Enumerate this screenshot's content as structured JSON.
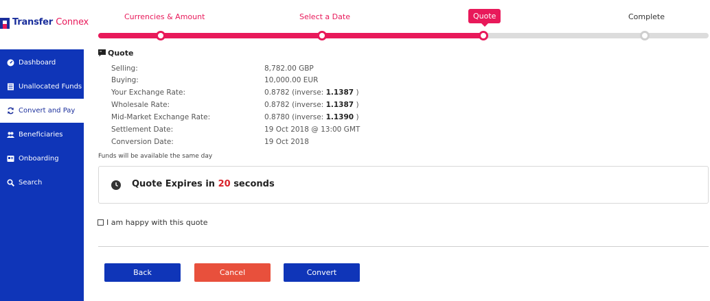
{
  "brand": {
    "name_part1": "Transfer",
    "name_part2": "Connex",
    "color_primary": "#0f35b8",
    "color_accent": "#e8195a"
  },
  "sidebar": {
    "items": [
      {
        "label": "Dashboard",
        "icon": "dashboard-icon",
        "active": false
      },
      {
        "label": "Unallocated Funds",
        "icon": "ledger-icon",
        "active": false
      },
      {
        "label": "Convert and Pay",
        "icon": "refresh-icon",
        "active": true
      },
      {
        "label": "Beneficiaries",
        "icon": "users-icon",
        "active": false
      },
      {
        "label": "Onboarding",
        "icon": "onboarding-icon",
        "active": false
      },
      {
        "label": "Search",
        "icon": "search-icon",
        "active": false
      }
    ]
  },
  "steps": [
    {
      "label": "Currencies & Amount",
      "state": "done"
    },
    {
      "label": "Select a Date",
      "state": "done"
    },
    {
      "label": "Quote",
      "state": "active"
    },
    {
      "label": "Complete",
      "state": "pending"
    }
  ],
  "quote": {
    "title": "Quote",
    "selling_label": "Selling:",
    "selling_value": "8,782.00 GBP",
    "buying_label": "Buying:",
    "buying_value": "10,000.00 EUR",
    "your_rate_label": "Your Exchange Rate:",
    "your_rate_value": "0.8782",
    "your_rate_inverse": "1.1387",
    "wholesale_label": "Wholesale Rate:",
    "wholesale_value": "0.8782",
    "wholesale_inverse": "1.1387",
    "midmarket_label": "Mid-Market Exchange Rate:",
    "midmarket_value": "0.8780",
    "midmarket_inverse": "1.1390",
    "inverse_prefix": "(inverse:",
    "inverse_suffix": ")",
    "settlement_label": "Settlement Date:",
    "settlement_value": "19 Oct 2018 @ 13:00 GMT",
    "conversion_label": "Conversion Date:",
    "conversion_value": "19 Oct 2018",
    "funds_note": "Funds will be available the same day"
  },
  "expiry": {
    "prefix": "Quote Expires in",
    "seconds": "20",
    "suffix": "seconds"
  },
  "agree": {
    "label": "I am happy with this quote",
    "checked": false
  },
  "buttons": {
    "back": "Back",
    "cancel": "Cancel",
    "convert": "Convert"
  }
}
